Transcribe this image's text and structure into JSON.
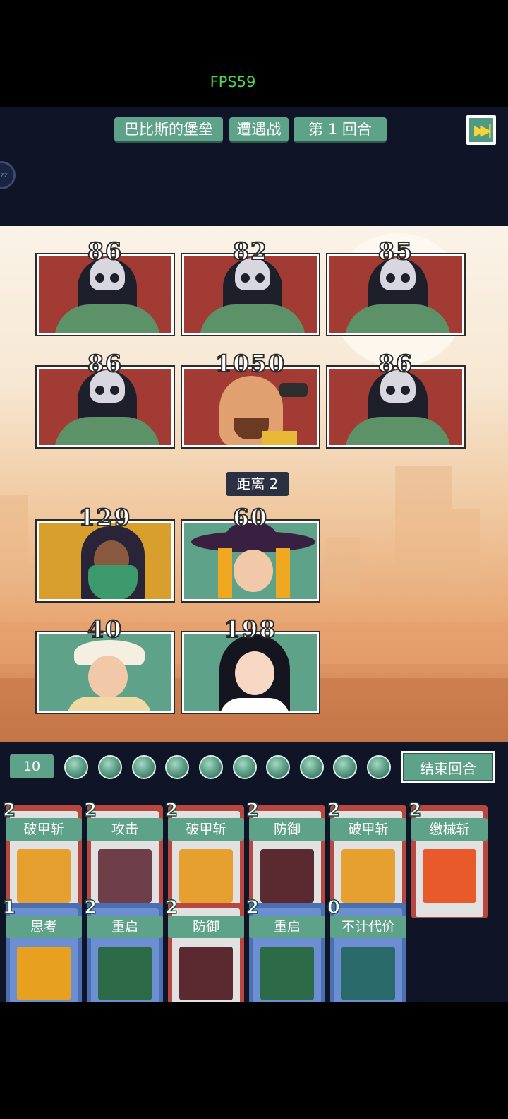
{
  "fps": "FPS59",
  "header": {
    "location": "巴比斯的堡垒",
    "battle_type": "遭遇战",
    "round": "第 1 回合",
    "skip_icon": "fast-forward-icon"
  },
  "sleep_icon": "zz",
  "enemies": [
    {
      "hp": "86",
      "kind": "hooded-creature"
    },
    {
      "hp": "82",
      "kind": "hooded-creature"
    },
    {
      "hp": "85",
      "kind": "hooded-creature"
    },
    {
      "hp": "86",
      "kind": "hooded-creature"
    },
    {
      "hp": "1050",
      "kind": "bandit-boss"
    },
    {
      "hp": "86",
      "kind": "hooded-creature"
    }
  ],
  "distance": "距离 2",
  "allies": [
    {
      "hp": "129",
      "kind": "masked-rogue"
    },
    {
      "hp": "60",
      "kind": "witch"
    },
    {
      "hp": "40",
      "kind": "explorer"
    },
    {
      "hp": "198",
      "kind": "black-haired-girl"
    }
  ],
  "energy": {
    "value": "10",
    "orbs": 10
  },
  "end_turn": "结束回合",
  "cards_row1": [
    {
      "cost": "2",
      "name": "破甲斩",
      "art": "armor-break-icon"
    },
    {
      "cost": "2",
      "name": "攻击",
      "art": "sword-icon"
    },
    {
      "cost": "2",
      "name": "破甲斩",
      "art": "armor-break-icon"
    },
    {
      "cost": "2",
      "name": "防御",
      "art": "shield-icon"
    },
    {
      "cost": "2",
      "name": "破甲斩",
      "art": "armor-break-icon"
    },
    {
      "cost": "2",
      "name": "缴械斩",
      "art": "disarm-slash-icon"
    }
  ],
  "cards_row2": [
    {
      "cost": "1",
      "name": "思考",
      "art": "eye-icon"
    },
    {
      "cost": "2",
      "name": "重启",
      "art": "spiral-hand-icon"
    },
    {
      "cost": "2",
      "name": "防御",
      "art": "shield-icon"
    },
    {
      "cost": "2",
      "name": "重启",
      "art": "spiral-hand-icon"
    },
    {
      "cost": "0",
      "name": "不计代价",
      "art": "skull-icon"
    }
  ],
  "colors": {
    "accent": "#5fa28a",
    "enemy_bg": "#a13b34",
    "dark": "#0f1527"
  }
}
